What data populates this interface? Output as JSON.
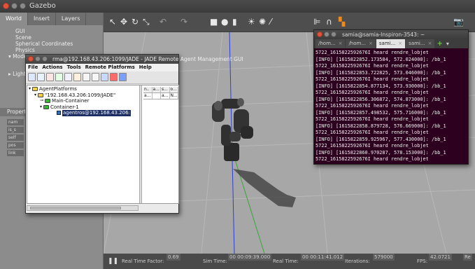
{
  "gazebo": {
    "window_title": "Gazebo",
    "tabs": [
      "World",
      "Insert",
      "Layers"
    ],
    "world_tree": [
      "GUI",
      "Scene",
      "Spherical Coordinates",
      "Physics",
      "Models",
      "Lights"
    ],
    "props_header": "Property",
    "prop_rows": [
      "nam",
      "is_s",
      "self",
      "pos",
      "link"
    ],
    "toolbar_icons": [
      "select-arrow",
      "translate",
      "rotate",
      "scale",
      "undo",
      "redo",
      "box",
      "sphere",
      "cylinder",
      "point-light",
      "spot-light",
      "directional-light",
      "align",
      "snap",
      "camera",
      "screenshot"
    ],
    "status": {
      "real_time_factor_label": "Real Time Factor:",
      "real_time_factor": "0.69",
      "sim_time_label": "Sim Time:",
      "sim_time": "00 00:09:39.000",
      "real_time_label": "Real Time:",
      "real_time": "00 00:11:41.012",
      "iterations_label": "Iterations:",
      "iterations": "579000",
      "fps_label": "FPS:",
      "fps": "42.0721",
      "reset_label": "Re"
    }
  },
  "jade": {
    "window_title": "rma@192.168.43.206:1099/JADE - JADE Remote Agent Management GUI",
    "menu": [
      "File",
      "Actions",
      "Tools",
      "Remote Platforms",
      "Help"
    ],
    "tree": {
      "root": "AgentPlatforms",
      "platform": "\"192.168.43.206:1099/JADE\"",
      "main_container": "Main-Container",
      "container1": "Container-1",
      "agent": "agentros@192.168.43.206:"
    },
    "table_headers": [
      "n..",
      "a...",
      "s...",
      "o..."
    ],
    "table_row": [
      "a...",
      "",
      "a...",
      "N..."
    ]
  },
  "terminal": {
    "window_title": "samia@samia-Inspiron-3543: ~",
    "tabs": [
      "/hom...",
      "/hom...",
      "sami...",
      "sami..."
    ],
    "active_tab_index": 2,
    "lines": [
      "5722_1615822592676I heard rendre_lobjet",
      "[INFO] [1615822852.173584, 572.024000]: /bb_1",
      "5722_1615822592676I heard rendre_lobjet",
      "[INFO] [1615822853.722825, 573.046000]: /bb_1",
      "5722_1615822592676I heard rendre_lobjet",
      "[INFO] [1615822854.877134, 573.930000]: /bb_1",
      "5722_1615822592676I heard rendre_lobjet",
      "[INFO] [1615822856.306872, 574.873000]: /bb_1",
      "5722_1615822592676I heard rendre_lobjet",
      "[INFO] [1615822857.498532, 575.716000]: /bb_1",
      "5722_1615822592676I heard rendre_lobjet",
      "[INFO] [1615822858.879728, 576.669000]: /bb_1",
      "5722_1615822592676I heard rendre_lobjet",
      "[INFO] [1615822859.925967, 577.430000]: /bb_1",
      "5722_1615822592676I heard rendre_lobjet",
      "[INFO] [1615822860.970287, 578.153000]: /bb_1",
      "5722_1615822592676I heard rendre_lobjet"
    ]
  }
}
